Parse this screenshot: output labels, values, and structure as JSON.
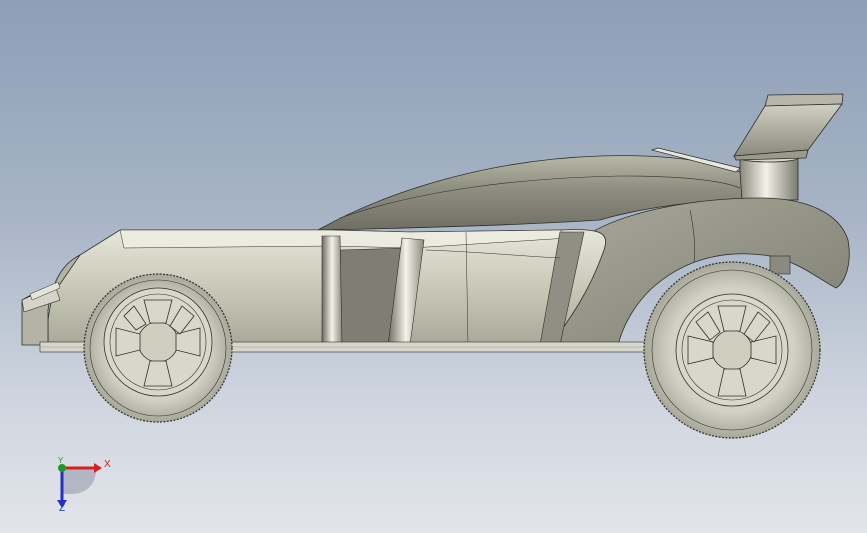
{
  "viewport": {
    "background_top": "#8d9eb6",
    "background_bottom": "#e2e5ea",
    "model_color": "#c8c8b6"
  },
  "triad": {
    "x_label": "X",
    "y_label": "Y",
    "z_label": "Z",
    "x_color": "#d32020",
    "y_color": "#1e9a22",
    "z_color": "#2330c8"
  }
}
